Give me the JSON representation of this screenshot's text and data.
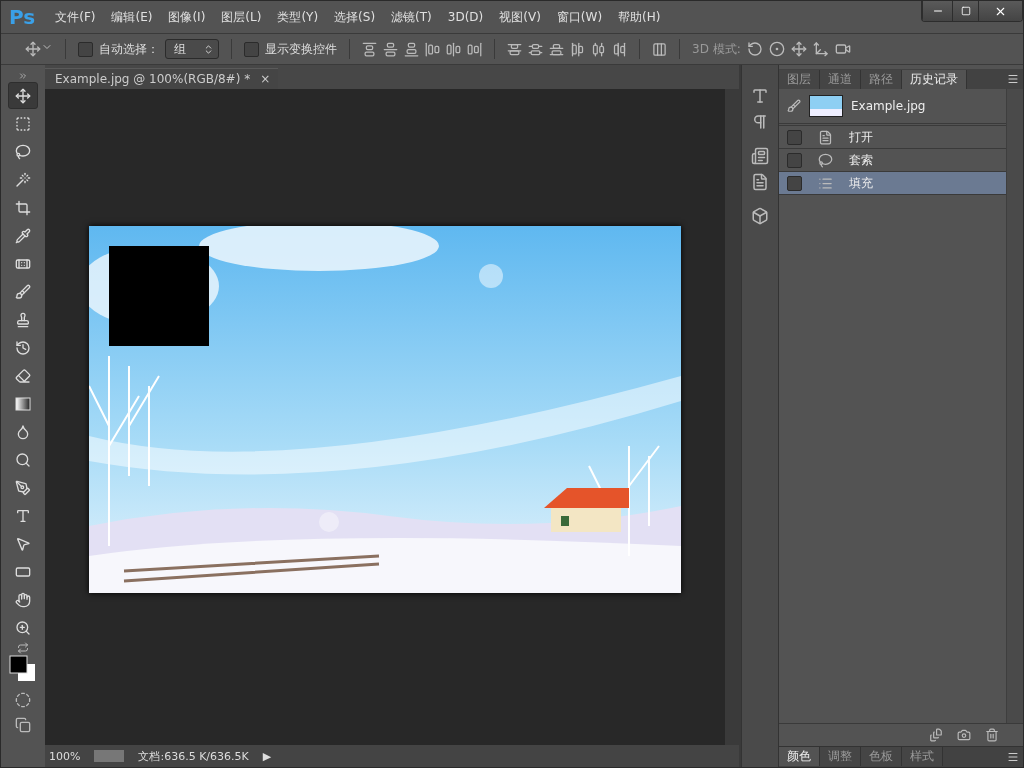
{
  "app": {
    "logo": "Ps"
  },
  "menu": [
    "文件(F)",
    "编辑(E)",
    "图像(I)",
    "图层(L)",
    "类型(Y)",
    "选择(S)",
    "滤镜(T)",
    "3D(D)",
    "视图(V)",
    "窗口(W)",
    "帮助(H)"
  ],
  "options_bar": {
    "auto_select": {
      "label": "自动选择：",
      "checked": false
    },
    "auto_select_target": "组",
    "show_transform": {
      "label": "显示变换控件",
      "checked": false
    },
    "mode_3d_label": "3D 模式:"
  },
  "document_tab": {
    "title": "Example.jpg @ 100%(RGB/8#) *",
    "close": "×"
  },
  "tools": [
    {
      "selected": true
    },
    {
      "selected": false
    },
    {
      "selected": false
    },
    {
      "selected": false
    },
    {
      "selected": false
    },
    {
      "selected": false
    },
    {
      "selected": false
    },
    {
      "selected": false
    },
    {
      "selected": false
    },
    {
      "selected": false
    },
    {
      "selected": false
    },
    {
      "selected": false
    },
    {
      "selected": false
    },
    {
      "selected": false
    },
    {
      "selected": false
    },
    {
      "selected": false
    },
    {
      "selected": false
    },
    {
      "selected": false
    },
    {
      "selected": false
    },
    {
      "selected": false
    }
  ],
  "status_bar": {
    "zoom": "100%",
    "doc_info": "文档:636.5 K/636.5K",
    "menu_arrow": "▶"
  },
  "panel_tabs": [
    {
      "label": "图层",
      "selected": false
    },
    {
      "label": "通道",
      "selected": false
    },
    {
      "label": "路径",
      "selected": false
    },
    {
      "label": "历史记录",
      "selected": true
    }
  ],
  "history": {
    "snapshot": "Example.jpg",
    "items": [
      {
        "label": "打开",
        "checked": false,
        "selected": false
      },
      {
        "label": "套索",
        "checked": false,
        "selected": false
      },
      {
        "label": "填充",
        "checked": false,
        "selected": true
      }
    ]
  },
  "bottom_tabs": [
    {
      "label": "颜色",
      "selected": true
    },
    {
      "label": "调整",
      "selected": false
    },
    {
      "label": "色板",
      "selected": false
    },
    {
      "label": "样式",
      "selected": false
    }
  ]
}
